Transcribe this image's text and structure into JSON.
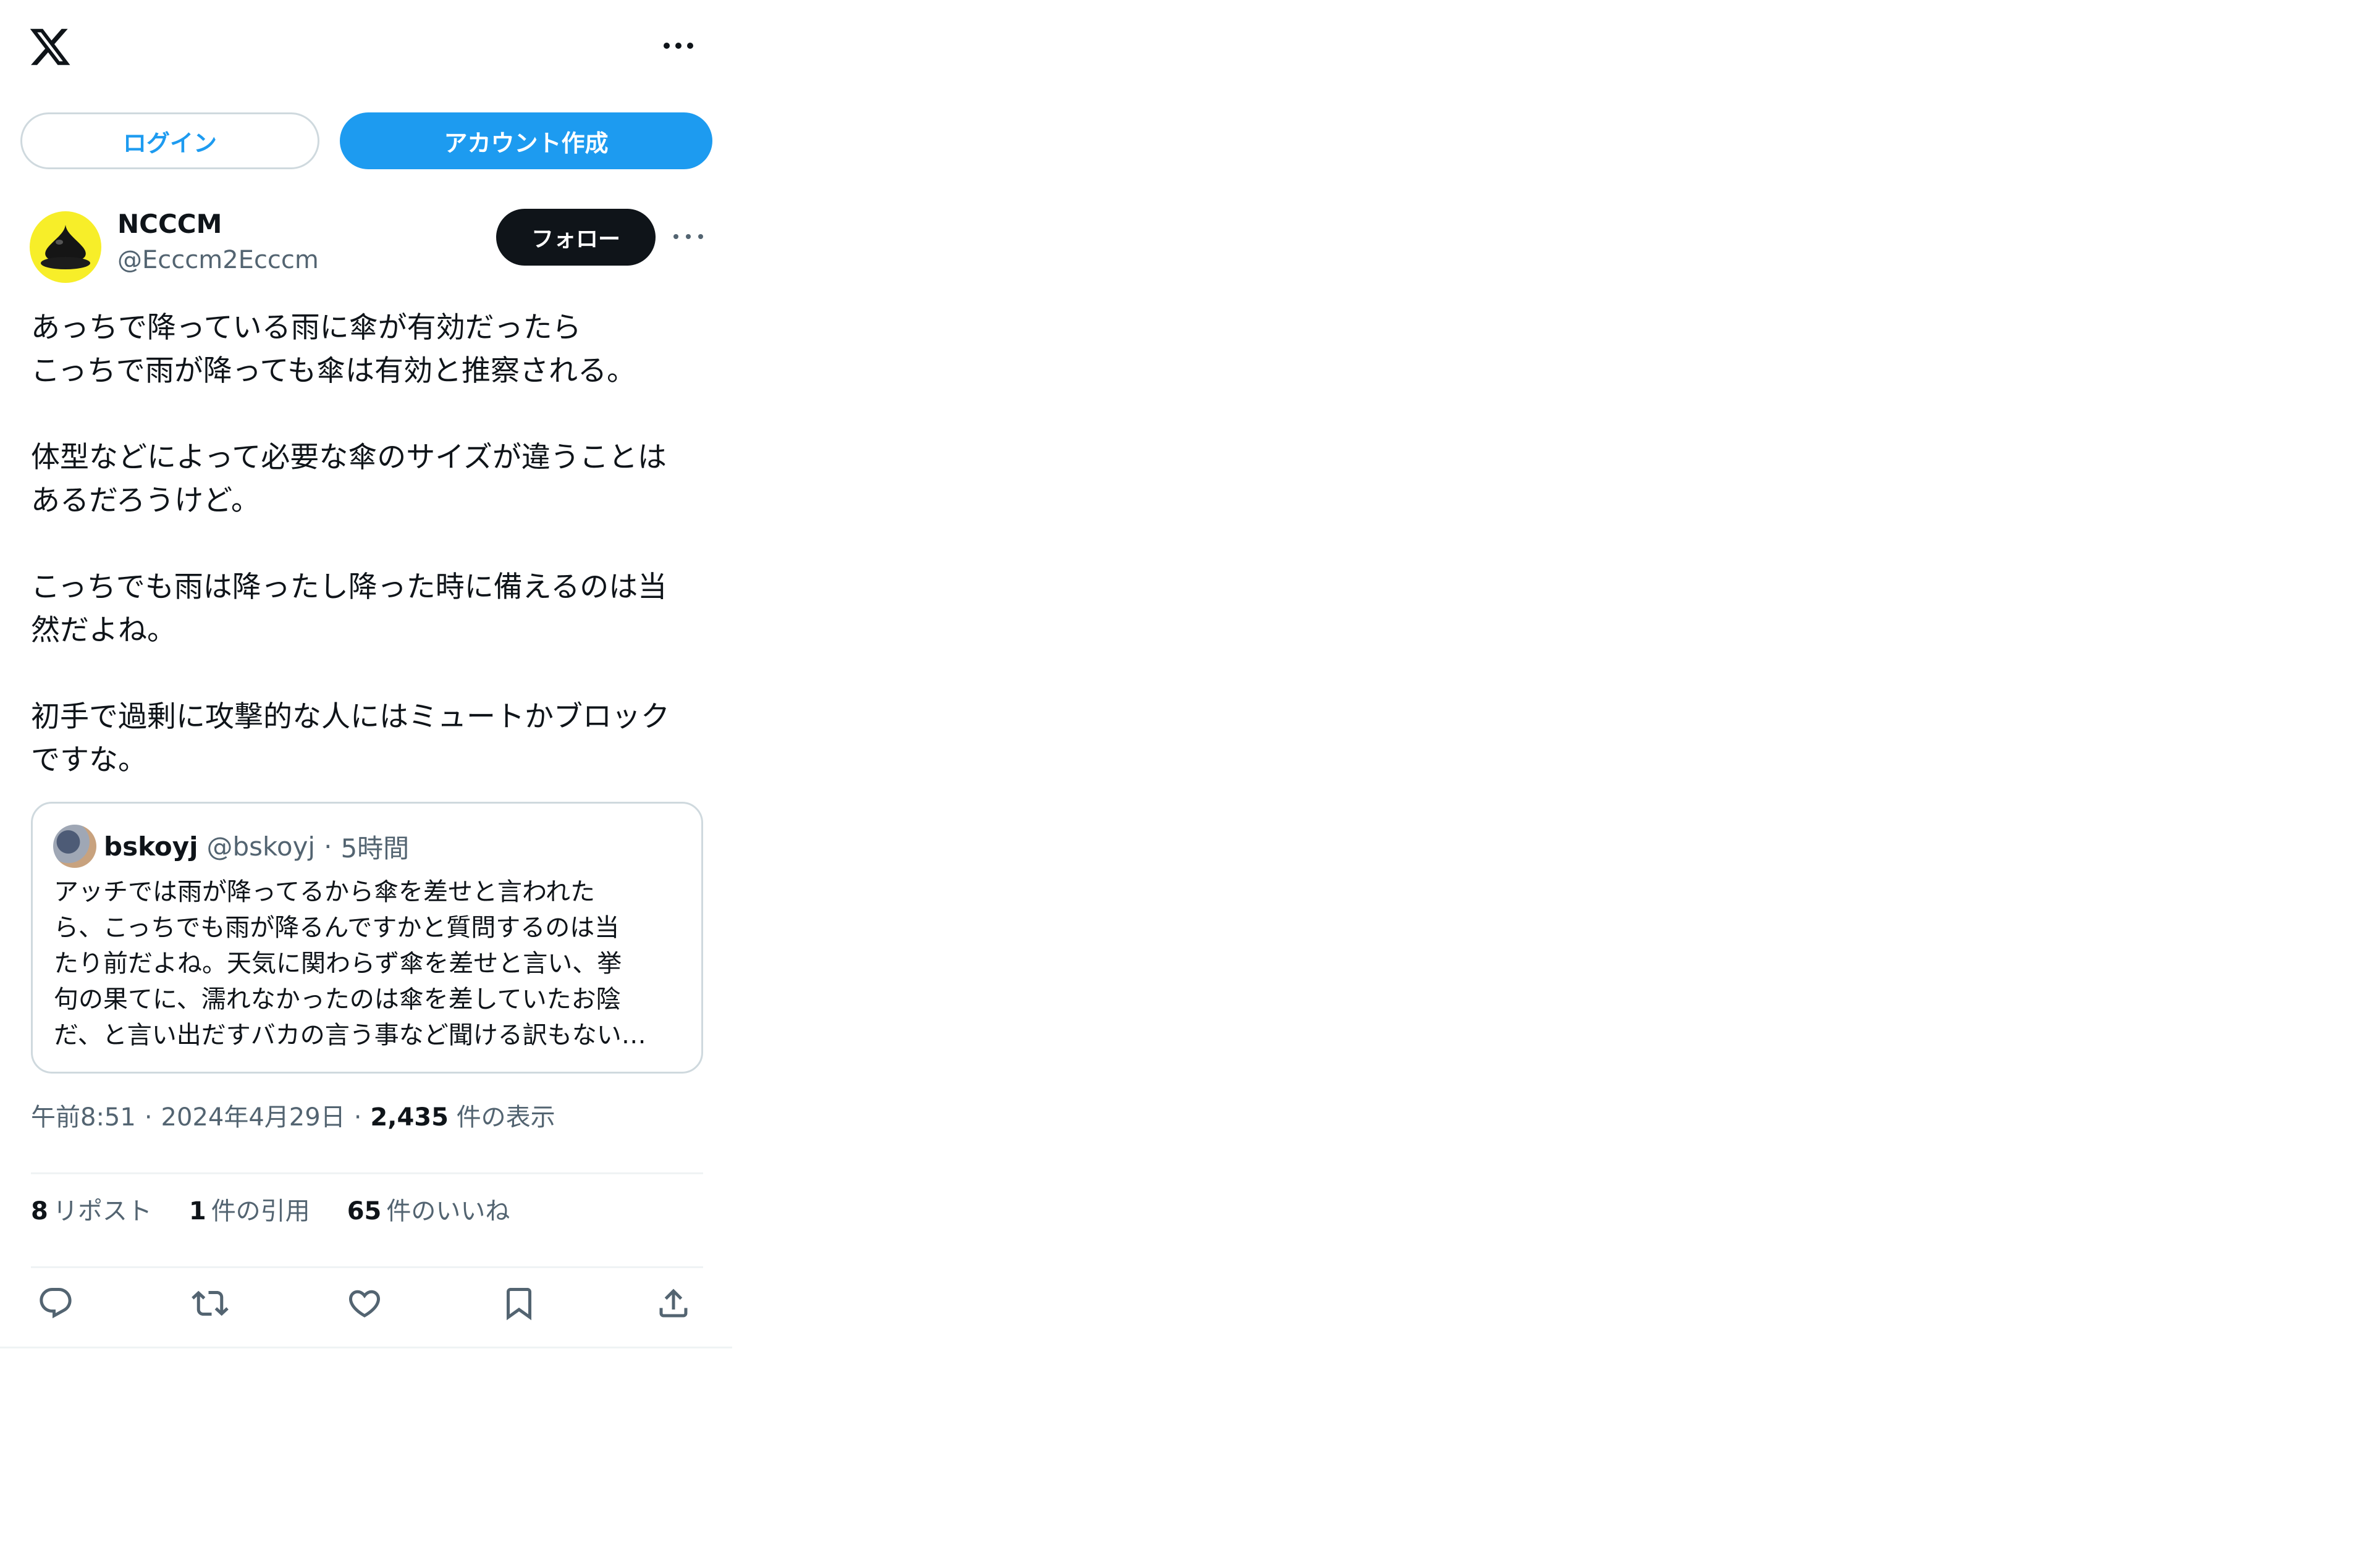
{
  "header": {
    "logo": "x-logo",
    "more": "more-options-icon"
  },
  "auth": {
    "login_label": "ログイン",
    "signup_label": "アカウント作成"
  },
  "author": {
    "name": "NCCCM",
    "handle": "@Ecccm2Ecccm",
    "follow_label": "フォロー"
  },
  "tweet": {
    "paragraphs": [
      "あっちで降っている雨に傘が有効だったら\nこっちで雨が降っても傘は有効と推察される。",
      "体型などによって必要な傘のサイズが違うことは\nあるだろうけど。",
      "こっちでも雨は降ったし降った時に備えるのは当\n然だよね。",
      "初手で過剰に攻撃的な人にはミュートかブロック\nですな。"
    ]
  },
  "quote": {
    "name": "bskoyj",
    "handle": "@bskoyj",
    "separator": "·",
    "time": "5時間",
    "lines": [
      "アッチでは雨が降ってるから傘を差せと言われた",
      "ら、こっちでも雨が降るんですかと質問するのは当",
      "たり前だよね。天気に関わらず傘を差せと言い、挙",
      "句の果てに、濡れなかったのは傘を差していたお陰",
      "だ、と言い出だすバカの言う事など聞ける訳もない…"
    ]
  },
  "meta": {
    "time": "午前8:51",
    "date": "2024年4月29日",
    "separator": "·",
    "views_count": "2,435",
    "views_label": "件の表示"
  },
  "stats": {
    "reposts_count": "8",
    "reposts_label": "リポスト",
    "quotes_count": "1",
    "quotes_label": "件の引用",
    "likes_count": "65",
    "likes_label": "件のいいね"
  },
  "actions": [
    "reply-icon",
    "repost-icon",
    "like-icon",
    "bookmark-icon",
    "share-icon"
  ]
}
